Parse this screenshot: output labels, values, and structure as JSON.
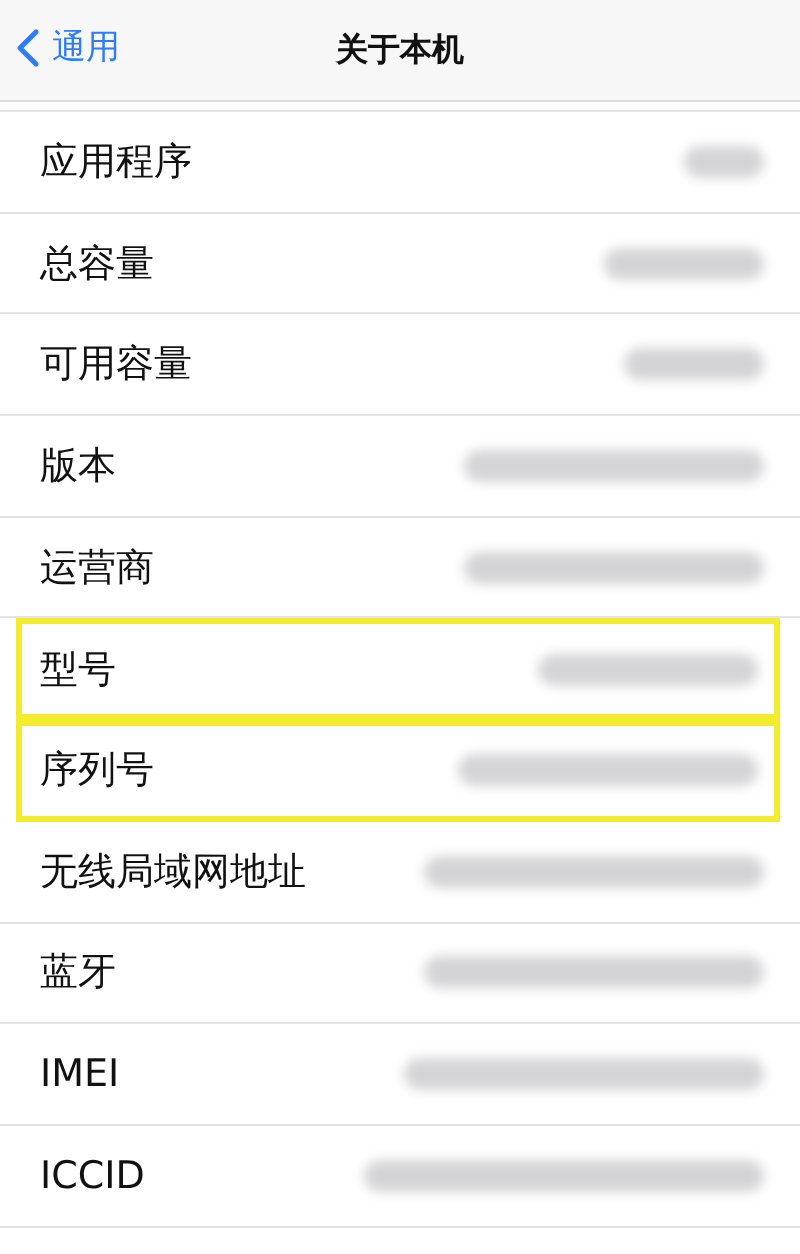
{
  "nav": {
    "back": "通用",
    "title": "关于本机"
  },
  "rows": [
    {
      "label": "应用程序",
      "highlighted": false
    },
    {
      "label": "总容量",
      "highlighted": false
    },
    {
      "label": "可用容量",
      "highlighted": false
    },
    {
      "label": "版本",
      "highlighted": false
    },
    {
      "label": "运营商",
      "highlighted": false
    },
    {
      "label": "型号",
      "highlighted": true
    },
    {
      "label": "序列号",
      "highlighted": true
    },
    {
      "label": "无线局域网地址",
      "highlighted": false
    },
    {
      "label": "蓝牙",
      "highlighted": false
    },
    {
      "label": "IMEI",
      "highlighted": false
    },
    {
      "label": "ICCID",
      "highlighted": false
    }
  ]
}
